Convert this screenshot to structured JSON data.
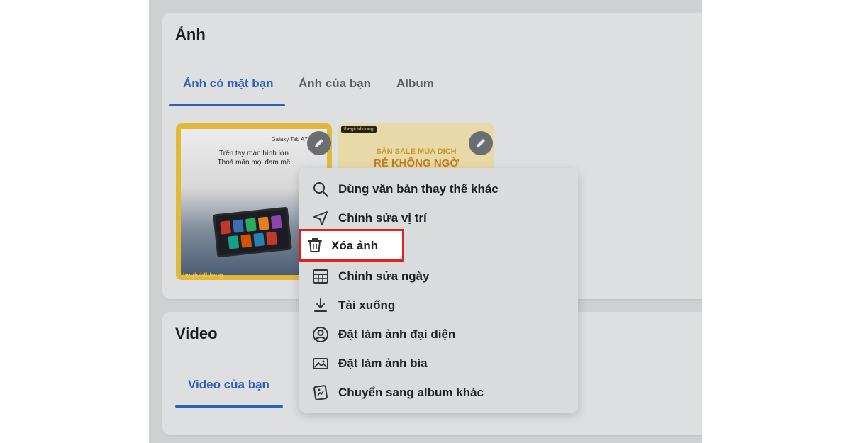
{
  "photos": {
    "title": "Ảnh",
    "tabs": [
      "Ảnh có mặt bạn",
      "Ảnh của bạn",
      "Album"
    ],
    "thumb1": {
      "brand": "Galaxy Tab A7 Lite",
      "line1": "Trên tay màn hình lớn",
      "line2": "Thoả mãn mọi đam mê",
      "logo": "thegioididong"
    },
    "thumb2": {
      "badge": "thegioididong",
      "line1": "SĂN SALE MÙA DỊCH",
      "line2": "RẺ KHÔNG NGỜ"
    }
  },
  "video": {
    "title": "Video",
    "tab": "Video của bạn"
  },
  "menu": {
    "items": [
      {
        "label": "Dùng văn bản thay thế khác",
        "icon": "search-icon"
      },
      {
        "label": "Chỉnh sửa vị trí",
        "icon": "location-arrow-icon"
      },
      {
        "label": "Xóa ảnh",
        "icon": "trash-icon"
      },
      {
        "label": "Chỉnh sửa ngày",
        "icon": "calendar-icon"
      },
      {
        "label": "Tải xuống",
        "icon": "download-icon"
      },
      {
        "label": "Đặt làm ảnh đại diện",
        "icon": "profile-icon"
      },
      {
        "label": "Đặt làm ảnh bìa",
        "icon": "cover-photo-icon"
      },
      {
        "label": "Chuyển sang album khác",
        "icon": "move-album-icon"
      }
    ]
  },
  "colors": {
    "accent": "#2d5fb8",
    "highlight_border": "#e0201e",
    "background": "#cfd0d2"
  }
}
